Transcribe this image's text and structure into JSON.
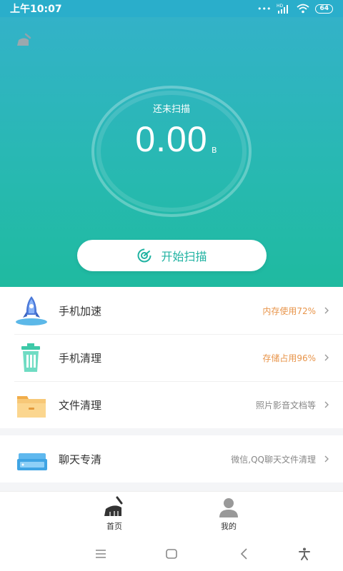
{
  "status_bar": {
    "time": "上午10:07",
    "network": "HD",
    "battery": "64"
  },
  "hero": {
    "scan_status": "还未扫描",
    "size_value": "0.00",
    "size_unit": "B",
    "scan_button_label": "开始扫描"
  },
  "features": [
    {
      "title": "手机加速",
      "detail": "内存使用72%",
      "highlight": true,
      "icon": "rocket-icon"
    },
    {
      "title": "手机清理",
      "detail": "存储占用96%",
      "highlight": true,
      "icon": "trash-bin-icon"
    },
    {
      "title": "文件清理",
      "detail": "照片影音文档等",
      "highlight": false,
      "icon": "folder-icon"
    }
  ],
  "chat": {
    "title": "聊天专清",
    "detail": "微信,QQ聊天文件清理",
    "icon": "chat-drawer-icon"
  },
  "tabs": {
    "home": "首页",
    "mine": "我的"
  },
  "colors": {
    "accent": "#21b3a2",
    "hero_top": "#33b2c8",
    "hero_bottom": "#1fbaa0",
    "warning": "#e8954b"
  }
}
